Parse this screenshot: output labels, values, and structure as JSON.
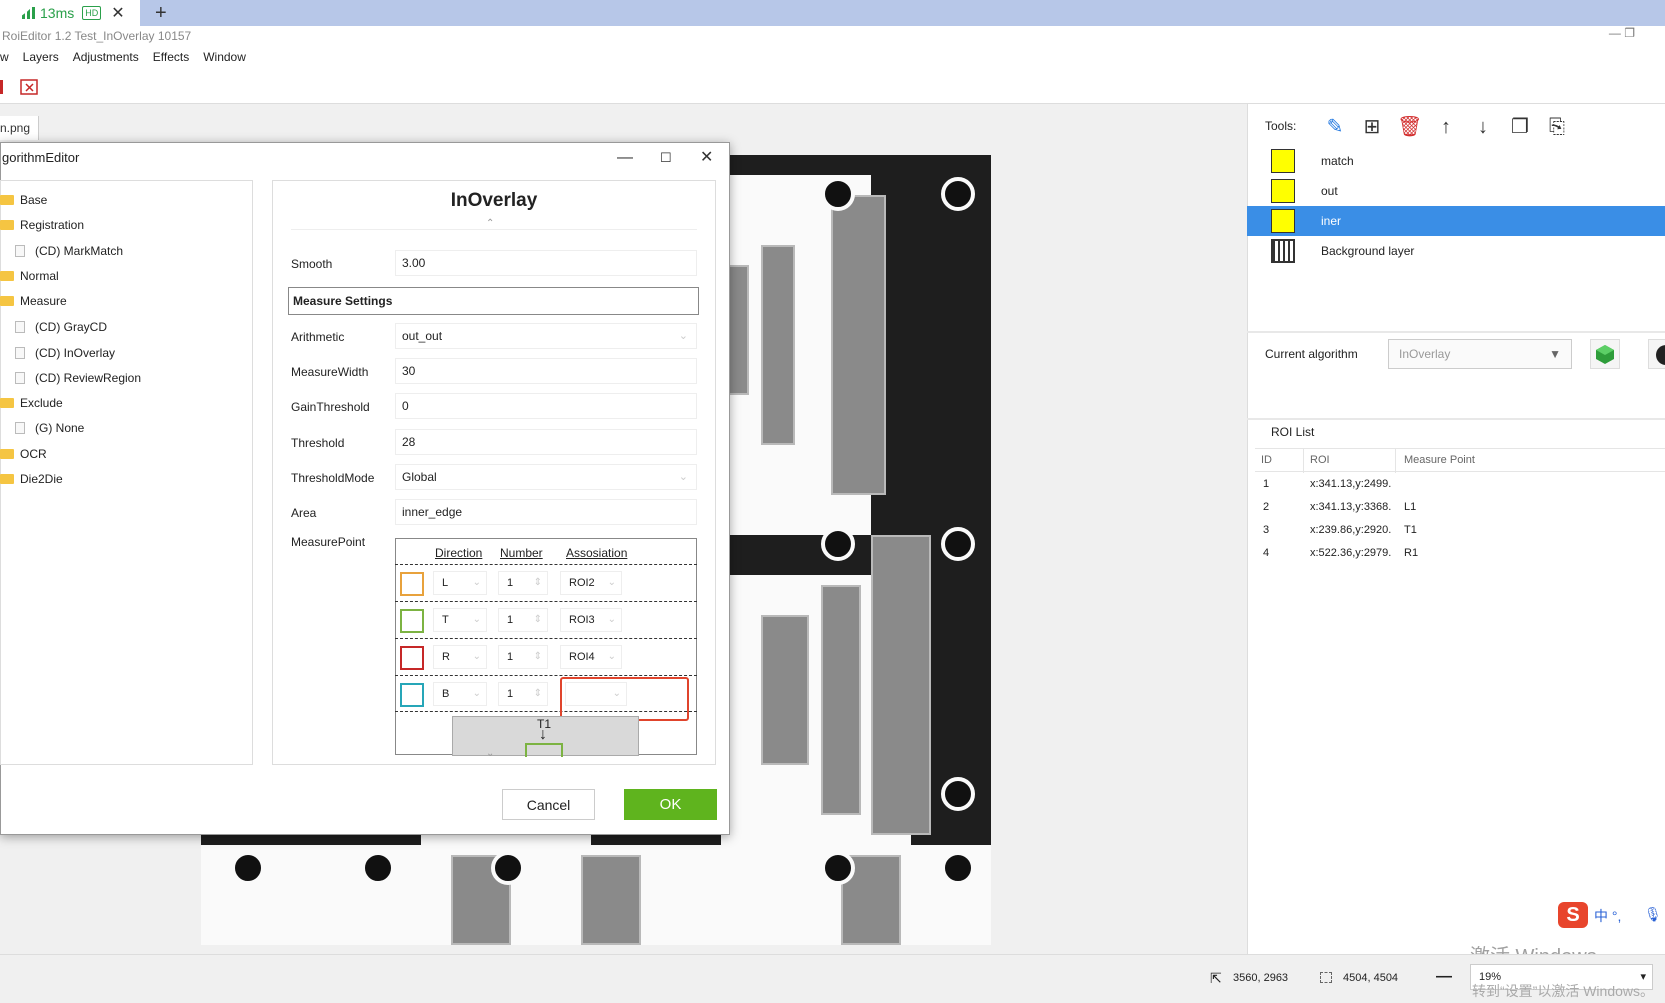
{
  "browser": {
    "tab_label": "13ms",
    "tab_badge": "HD",
    "tab_close": "✕",
    "new_tab": "+"
  },
  "window": {
    "title": "RoiEditor 1.2 Test_InOverlay 10157",
    "controls": "—   ❐"
  },
  "menu": [
    "w",
    "Layers",
    "Adjustments",
    "Effects",
    "Window"
  ],
  "image_tab": "n.png",
  "dialog": {
    "title": "gorithmEditor",
    "tree": [
      {
        "label": "Base",
        "type": "folder"
      },
      {
        "label": "Registration",
        "type": "folder"
      },
      {
        "label": "(CD) MarkMatch",
        "type": "file"
      },
      {
        "label": "Normal",
        "type": "folder"
      },
      {
        "label": "Measure",
        "type": "folder"
      },
      {
        "label": "(CD) GrayCD",
        "type": "file"
      },
      {
        "label": "(CD) InOverlay",
        "type": "file"
      },
      {
        "label": "(CD) ReviewRegion",
        "type": "file"
      },
      {
        "label": "Exclude",
        "type": "folder"
      },
      {
        "label": "(G) None",
        "type": "file"
      },
      {
        "label": "OCR",
        "type": "folder"
      },
      {
        "label": "Die2Die",
        "type": "folder"
      }
    ],
    "panel_title": "InOverlay",
    "smooth": {
      "label": "Smooth",
      "value": "3.00"
    },
    "measure_settings": "Measure Settings",
    "props": [
      {
        "label": "Arithmetic",
        "value": "out_out"
      },
      {
        "label": "MeasureWidth",
        "value": "30"
      },
      {
        "label": "GainThreshold",
        "value": "0"
      },
      {
        "label": "Threshold",
        "value": "28"
      },
      {
        "label": "ThresholdMode",
        "value": "Global"
      },
      {
        "label": "Area",
        "value": "inner_edge"
      }
    ],
    "measure_point_label": "MeasurePoint",
    "mp_headers": {
      "direction": "Direction",
      "number": "Number",
      "association": "Assosiation"
    },
    "mp_rows": [
      {
        "direction": "L",
        "number": "1",
        "association": "ROI2",
        "color": "#e8a23c"
      },
      {
        "direction": "T",
        "number": "1",
        "association": "ROI3",
        "color": "#7cb342"
      },
      {
        "direction": "R",
        "number": "1",
        "association": "ROI4",
        "color": "#c62828"
      },
      {
        "direction": "B",
        "number": "1",
        "association": "",
        "color": "#26a6b8"
      }
    ],
    "preview_label": "T1",
    "cancel": "Cancel",
    "ok": "OK"
  },
  "right_panel": {
    "tools_label": "Tools:",
    "layers": [
      {
        "name": "match",
        "selected": false
      },
      {
        "name": "out",
        "selected": false
      },
      {
        "name": "iner",
        "selected": true
      },
      {
        "name": "Background layer",
        "selected": false
      }
    ],
    "current_algorithm_label": "Current algorithm",
    "current_algorithm_value": "InOverlay",
    "roi_list_title": "ROI List",
    "roi_headers": [
      "ID",
      "ROI",
      "Measure Point"
    ],
    "roi_rows": [
      {
        "id": "1",
        "roi": "x:341.13,y:2499.",
        "mp": ""
      },
      {
        "id": "2",
        "roi": "x:341.13,y:3368.",
        "mp": "L1"
      },
      {
        "id": "3",
        "roi": "x:239.86,y:2920.",
        "mp": "T1"
      },
      {
        "id": "4",
        "roi": "x:522.36,y:2979.",
        "mp": "R1"
      }
    ]
  },
  "status": {
    "cursor": "3560, 2963",
    "size": "4504, 4504",
    "zoom": "19%",
    "activate_title": "激活 Windows",
    "activate_sub": "转到“设置”以激活 Windows。",
    "ime": "中 °,"
  }
}
